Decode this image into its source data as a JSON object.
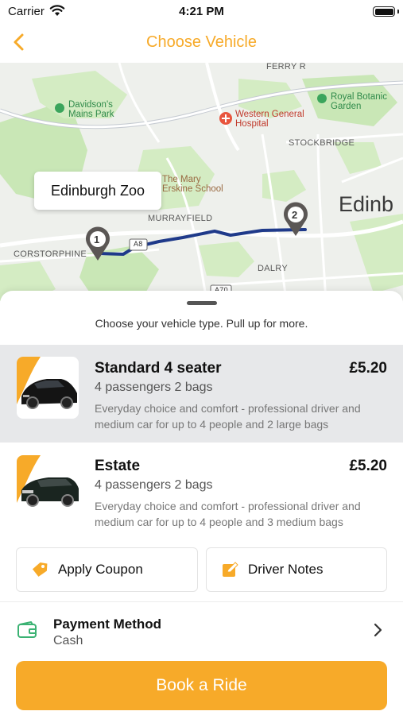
{
  "status_bar": {
    "carrier": "Carrier",
    "time": "4:21 PM"
  },
  "nav": {
    "title": "Choose Vehicle",
    "back_icon": "chevron-left-icon"
  },
  "map": {
    "callout": "Edinburgh Zoo",
    "city": "Edinb",
    "labels": {
      "ferry_rd": "FERRY R",
      "davidsons": "Davidson's\nMains Park",
      "western_general": "Western General\nHospital",
      "royal_botanic": "Royal Botanic\nGarden",
      "stockbridge": "STOCKBRIDGE",
      "mary_erskine": "The Mary\nErskine School",
      "murrayfield": "MURRAYFIELD",
      "corstorphine": "CORSTORPHINE",
      "dalry": "DALRY",
      "road_a8": "A8",
      "road_a70": "A70"
    },
    "pins": [
      {
        "label": "1"
      },
      {
        "label": "2"
      }
    ],
    "colors": {
      "route": "#1F3A8A",
      "pin": "#5B5755",
      "park": "#C9E7B6"
    }
  },
  "sheet": {
    "hint": "Choose your vehicle type. Pull up for more."
  },
  "vehicles": [
    {
      "name": "Standard 4 seater",
      "price": "£5.20",
      "capacity": "4 passengers  2 bags",
      "description": "Everyday choice and comfort - professional driver and medium car for up to 4 people and 2 large bags",
      "selected": true
    },
    {
      "name": "Estate",
      "price": "£5.20",
      "capacity": "4 passengers  2 bags",
      "description": "Everyday choice and comfort - professional driver and medium car for up to 4 people and  3 medium bags",
      "selected": false
    }
  ],
  "actions": {
    "coupon": {
      "label": "Apply Coupon",
      "icon": "tag-icon"
    },
    "notes": {
      "label": "Driver Notes",
      "icon": "edit-note-icon"
    }
  },
  "payment": {
    "title": "Payment Method",
    "value": "Cash",
    "icon": "wallet-icon"
  },
  "book_button": {
    "label": "Book a Ride"
  },
  "colors": {
    "accent": "#F7AA29",
    "selected_row": "#E7E8EA",
    "payment_icon": "#3BB273"
  }
}
